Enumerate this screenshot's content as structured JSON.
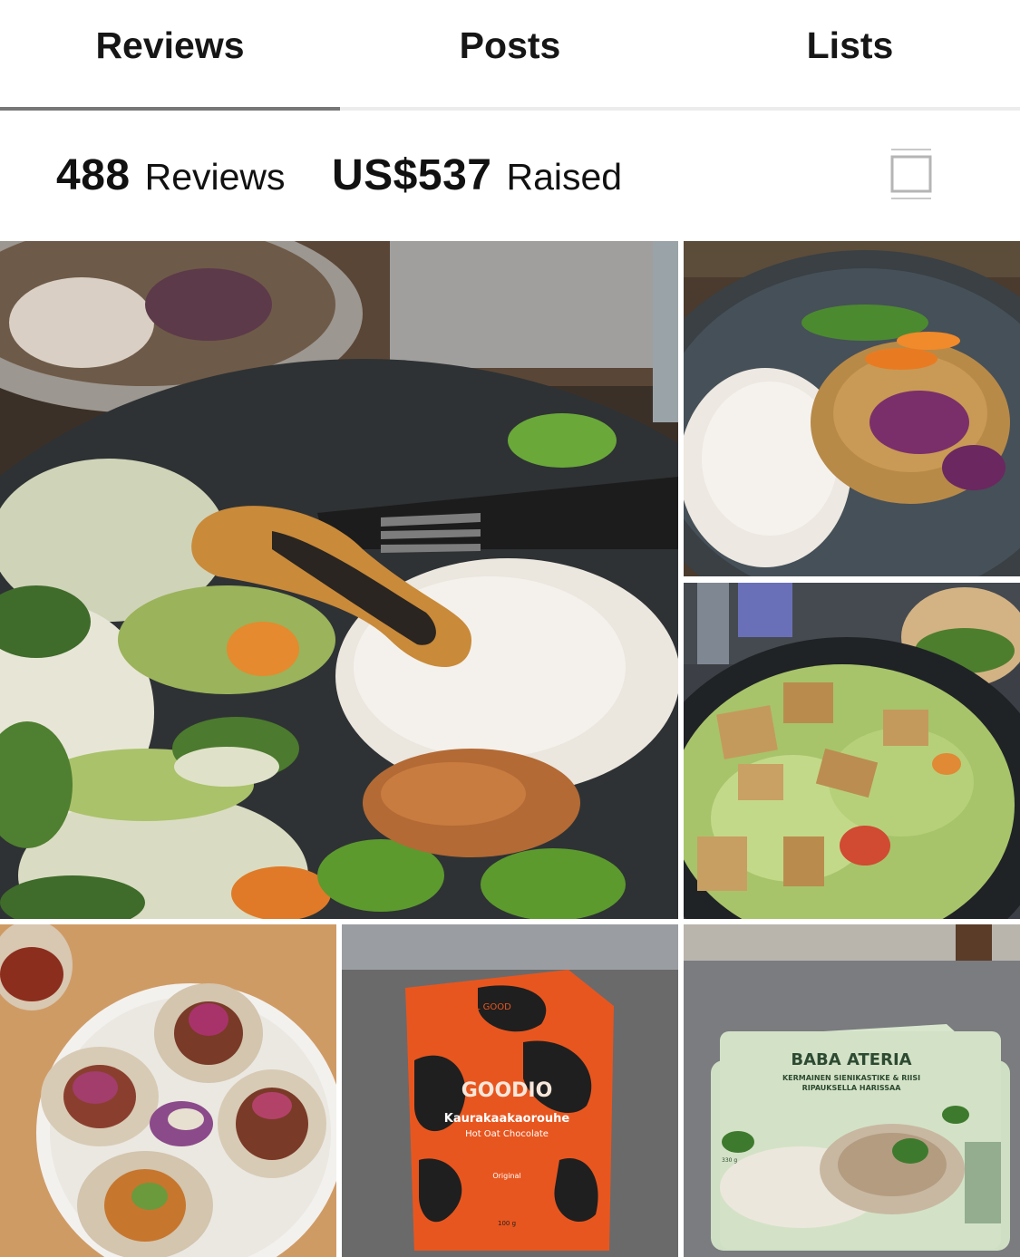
{
  "tabs": [
    {
      "label": "Reviews",
      "active": true
    },
    {
      "label": "Posts",
      "active": false
    },
    {
      "label": "Lists",
      "active": false
    }
  ],
  "stats": {
    "reviews_count": "488",
    "reviews_label": "Reviews",
    "raised_amount": "US$537",
    "raised_label": "Raised"
  },
  "view_toggle_icon": "layout-toggle-icon",
  "photos": {
    "goodio_box": {
      "brand": "GOODIO",
      "product": "Kaurakaakaorouhe",
      "subtitle": "Hot Oat Chocolate",
      "variant": "Original",
      "weight": "100 g",
      "badge": "IT'S ALL GOOD"
    },
    "baba_tray": {
      "brand": "BABA ATERIA",
      "line1": "KERMAINEN SIENIKASTIKE & RIISI",
      "line2": "RIPAUKSELLA HARISSAA",
      "weight": "330 g"
    }
  },
  "colors": {
    "tab_active_underline": "#777777",
    "divider": "#ececec",
    "text": "#111111"
  }
}
